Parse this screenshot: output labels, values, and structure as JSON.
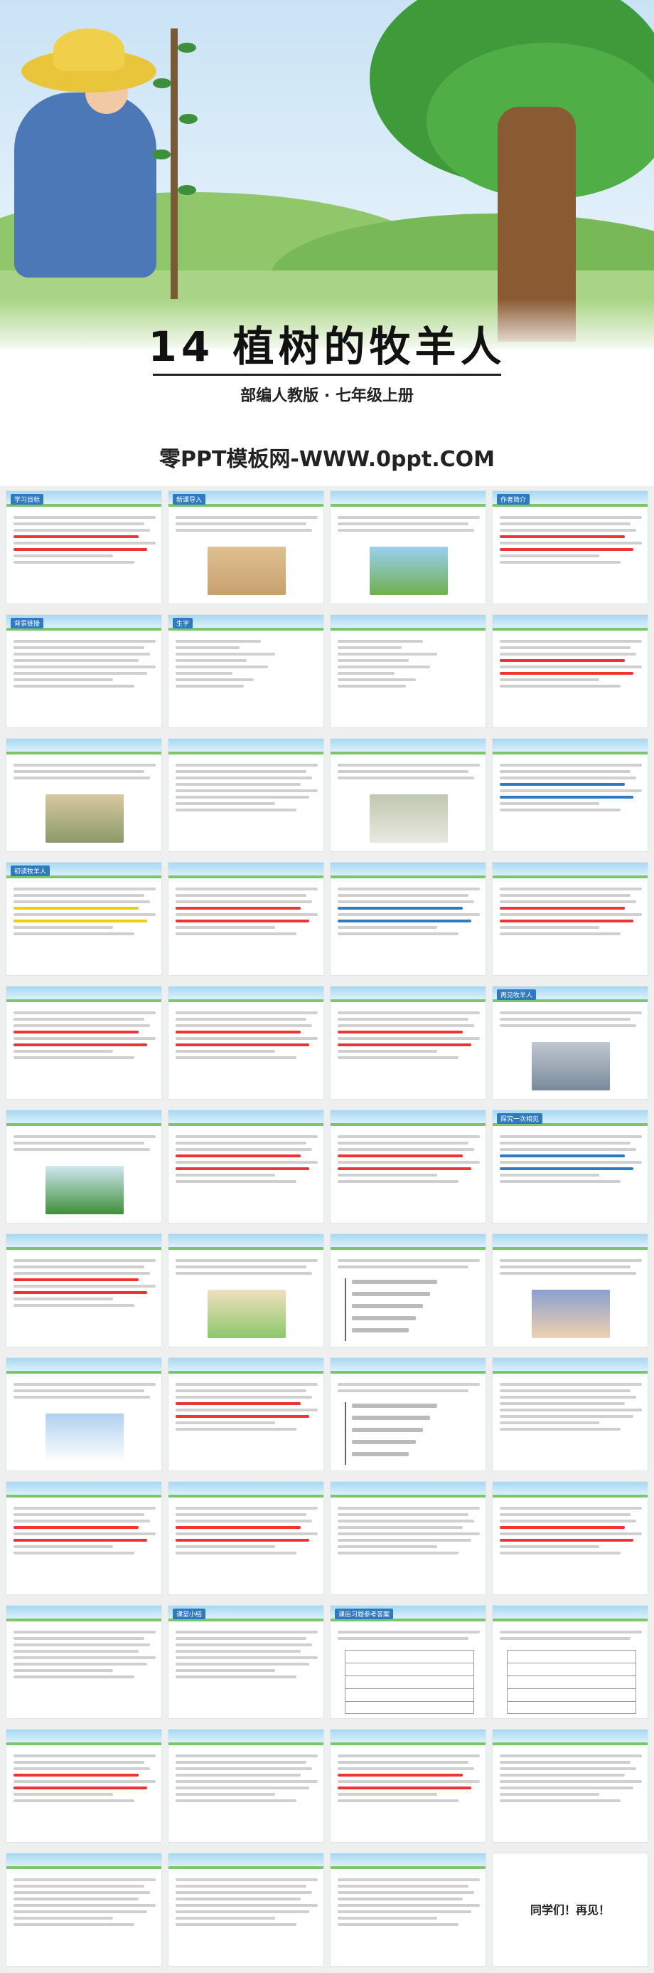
{
  "cover": {
    "title": "14 植树的牧羊人",
    "subtitle": "部编人教版 · 七年级上册",
    "brand": "零PPT模板网-WWW.0ppt.COM"
  },
  "slides": [
    {
      "tag": "学习目标",
      "kind": "text",
      "accent": "#e33"
    },
    {
      "tag": "新课导入",
      "kind": "text-pic",
      "pic": "desert"
    },
    {
      "tag": "",
      "kind": "text-pic",
      "pic": "grass"
    },
    {
      "tag": "作者简介",
      "kind": "text",
      "accent": "#e33"
    },
    {
      "tag": "背景链接",
      "kind": "text"
    },
    {
      "tag": "生字",
      "kind": "pinyin"
    },
    {
      "tag": "",
      "kind": "pinyin"
    },
    {
      "tag": "",
      "kind": "text",
      "accent": "#e33"
    },
    {
      "tag": "",
      "kind": "text-pic",
      "pic": "village"
    },
    {
      "tag": "",
      "kind": "text"
    },
    {
      "tag": "",
      "kind": "text-pic",
      "pic": "sheep"
    },
    {
      "tag": "",
      "kind": "text",
      "accent": "#2e79c0"
    },
    {
      "tag": "初读牧羊人",
      "kind": "text",
      "accent": "#f0d000"
    },
    {
      "tag": "",
      "kind": "text",
      "accent": "#e33"
    },
    {
      "tag": "",
      "kind": "text",
      "accent": "#2e79c0"
    },
    {
      "tag": "",
      "kind": "text",
      "accent": "#e33"
    },
    {
      "tag": "",
      "kind": "text",
      "accent": "#e33"
    },
    {
      "tag": "",
      "kind": "text",
      "accent": "#e33"
    },
    {
      "tag": "",
      "kind": "text",
      "accent": "#e33"
    },
    {
      "tag": "再见牧羊人",
      "kind": "text-pic",
      "pic": "mountain"
    },
    {
      "tag": "",
      "kind": "text-pic",
      "pic": "tree"
    },
    {
      "tag": "",
      "kind": "text",
      "accent": "#e33"
    },
    {
      "tag": "",
      "kind": "text",
      "accent": "#e33"
    },
    {
      "tag": "探究一次相见",
      "kind": "text",
      "accent": "#2e79c0"
    },
    {
      "tag": "",
      "kind": "text",
      "accent": "#e33"
    },
    {
      "tag": "",
      "kind": "text-pic",
      "pic": "kids"
    },
    {
      "tag": "",
      "kind": "diagram"
    },
    {
      "tag": "",
      "kind": "text-pic",
      "pic": "girl"
    },
    {
      "tag": "",
      "kind": "text-pic",
      "pic": "cloud"
    },
    {
      "tag": "",
      "kind": "text",
      "accent": "#e33"
    },
    {
      "tag": "",
      "kind": "diagram"
    },
    {
      "tag": "",
      "kind": "text"
    },
    {
      "tag": "",
      "kind": "text",
      "accent": "#e33"
    },
    {
      "tag": "",
      "kind": "text",
      "accent": "#e33"
    },
    {
      "tag": "",
      "kind": "text"
    },
    {
      "tag": "",
      "kind": "text",
      "accent": "#e33"
    },
    {
      "tag": "",
      "kind": "text"
    },
    {
      "tag": "课堂小结",
      "kind": "text"
    },
    {
      "tag": "课后习题参考答案",
      "kind": "table"
    },
    {
      "tag": "",
      "kind": "table"
    },
    {
      "tag": "",
      "kind": "text",
      "accent": "#e33"
    },
    {
      "tag": "",
      "kind": "text"
    },
    {
      "tag": "",
      "kind": "text",
      "accent": "#e33"
    },
    {
      "tag": "",
      "kind": "text"
    },
    {
      "tag": "",
      "kind": "text"
    },
    {
      "tag": "",
      "kind": "text"
    },
    {
      "tag": "",
      "kind": "text"
    },
    {
      "tag": "",
      "kind": "final",
      "text": "同学们！再见！"
    }
  ]
}
